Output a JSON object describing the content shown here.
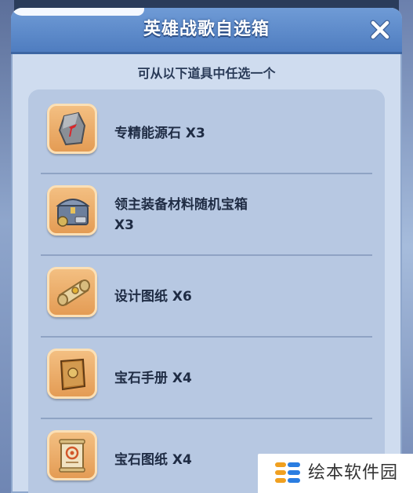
{
  "dialog": {
    "title": "英雄战歌自选箱",
    "subtitle": "可从以下道具中任选一个",
    "close_icon": "close-x-icon"
  },
  "items": [
    {
      "label": "专精能源石 X3",
      "icon": "stone-icon"
    },
    {
      "label": "领主装备材料随机宝箱\nX3",
      "icon": "treasure-chest-icon"
    },
    {
      "label": "设计图纸 X6",
      "icon": "scroll-icon"
    },
    {
      "label": "宝石手册 X4",
      "icon": "book-icon"
    },
    {
      "label": "宝石图纸 X4",
      "icon": "gem-scroll-icon"
    }
  ],
  "watermark": {
    "text": "绘本软件园",
    "icon": "logo-icon"
  },
  "colors": {
    "title_bar": "#4f7dc0",
    "panel": "#cfdcef",
    "list_bg": "#b7c8e2",
    "icon_frame": "#e39a52"
  }
}
